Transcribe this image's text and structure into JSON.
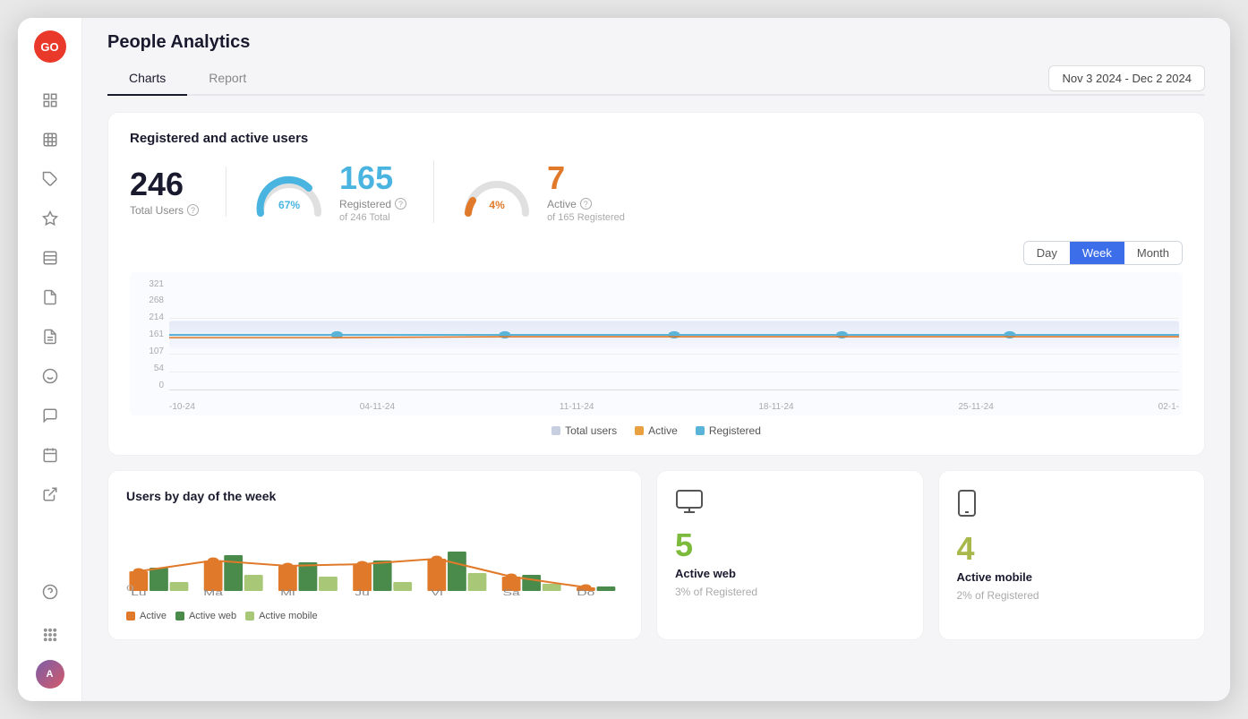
{
  "app": {
    "logo_text": "GO",
    "page_title": "People Analytics"
  },
  "sidebar": {
    "items": [
      {
        "id": "dashboard",
        "icon": "⊞",
        "active": false
      },
      {
        "id": "grid",
        "icon": "⊟",
        "active": false
      },
      {
        "id": "tag",
        "icon": "◇",
        "active": false
      },
      {
        "id": "star",
        "icon": "☆",
        "active": false
      },
      {
        "id": "layout",
        "icon": "▤",
        "active": false
      },
      {
        "id": "file1",
        "icon": "📄",
        "active": false
      },
      {
        "id": "file2",
        "icon": "📋",
        "active": false
      },
      {
        "id": "emoji",
        "icon": "☺",
        "active": false
      },
      {
        "id": "chat",
        "icon": "💬",
        "active": false
      },
      {
        "id": "calendar",
        "icon": "📅",
        "active": false
      },
      {
        "id": "external",
        "icon": "↗",
        "active": false
      }
    ],
    "bottom": [
      {
        "id": "help",
        "icon": "?"
      },
      {
        "id": "apps",
        "icon": "⠿"
      }
    ]
  },
  "tabs": [
    {
      "id": "charts",
      "label": "Charts",
      "active": true
    },
    {
      "id": "report",
      "label": "Report",
      "active": false
    }
  ],
  "date_range": {
    "label": "Nov 3 2024 - Dec 2 2024"
  },
  "registered_card": {
    "title": "Registered and active users",
    "total_users": {
      "number": "246",
      "label": "Total Users"
    },
    "registered": {
      "percent": "67%",
      "number": "165",
      "label": "Registered",
      "sub": "of 246 Total"
    },
    "active": {
      "percent": "4%",
      "number": "7",
      "label": "Active",
      "sub": "of 165 Registered"
    }
  },
  "chart": {
    "time_buttons": [
      "Day",
      "Week",
      "Month"
    ],
    "active_button": "Week",
    "y_labels": [
      "321",
      "268",
      "214",
      "161",
      "107",
      "54",
      "0"
    ],
    "x_labels": [
      "-10-24",
      "04-11-24",
      "11-11-24",
      "18-11-24",
      "25-11-24",
      "02-1-"
    ],
    "legend": [
      {
        "label": "Total users",
        "color": "#c8cfe0"
      },
      {
        "label": "Active",
        "color": "#e8a040"
      },
      {
        "label": "Registered",
        "color": "#5ab4d8"
      }
    ]
  },
  "week_card": {
    "title": "Users by day of the week",
    "x_labels": [
      "Lu",
      "Ma",
      "Mi",
      "Ju",
      "Vi",
      "Sa",
      "Do"
    ],
    "legend": [
      {
        "label": "Active",
        "color": "#e07a2a"
      },
      {
        "label": "Active web",
        "color": "#4a8a4a"
      },
      {
        "label": "Active mobile",
        "color": "#a8c878"
      }
    ],
    "bars": [
      {
        "active": 28,
        "web": 32,
        "mobile": 12
      },
      {
        "active": 42,
        "web": 48,
        "mobile": 18
      },
      {
        "active": 36,
        "web": 40,
        "mobile": 16
      },
      {
        "active": 38,
        "web": 44,
        "mobile": 10
      },
      {
        "active": 44,
        "web": 50,
        "mobile": 20
      },
      {
        "active": 20,
        "web": 22,
        "mobile": 8
      },
      {
        "active": 4,
        "web": 5,
        "mobile": 2
      }
    ],
    "line_points": [
      28,
      42,
      36,
      38,
      44,
      20,
      4
    ]
  },
  "active_web": {
    "icon": "🖥",
    "number": "5",
    "label": "Active web",
    "sub": "3% of Registered"
  },
  "active_mobile": {
    "icon": "📱",
    "number": "4",
    "label": "Active mobile",
    "sub": "2% of Registered"
  }
}
